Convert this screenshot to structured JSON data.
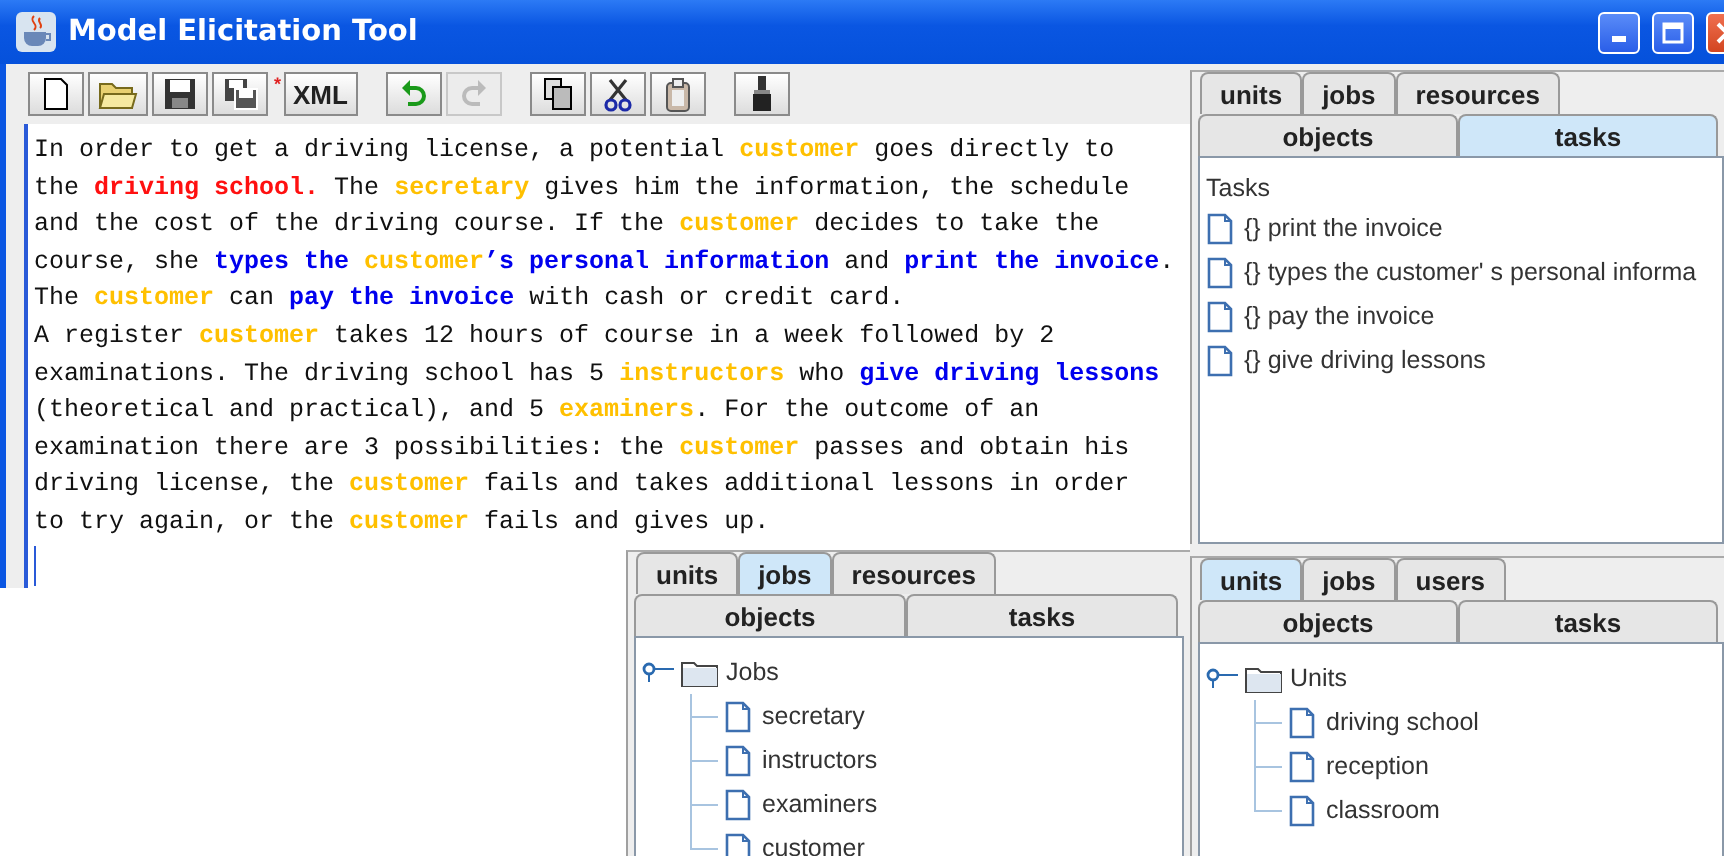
{
  "window": {
    "title": "Model Elicitation Tool"
  },
  "toolbar": {
    "items": [
      {
        "kind": "new",
        "disabled": false
      },
      {
        "kind": "open",
        "disabled": false
      },
      {
        "kind": "save",
        "disabled": false
      },
      {
        "kind": "saveas",
        "disabled": false
      },
      {
        "kind": "mark",
        "text": "*",
        "disabled": false
      },
      {
        "kind": "text",
        "text": "XML",
        "disabled": false
      },
      {
        "kind": "undo",
        "disabled": false
      },
      {
        "kind": "redo",
        "disabled": true
      },
      {
        "kind": "copy",
        "disabled": false
      },
      {
        "kind": "cut",
        "disabled": false
      },
      {
        "kind": "paste",
        "disabled": false
      },
      {
        "kind": "brush",
        "disabled": false
      }
    ]
  },
  "editor": {
    "lines": [
      [
        {
          "kind": "plain",
          "text": "In order to get a driving license, a potential "
        },
        {
          "kind": "job",
          "text": "customer"
        },
        {
          "kind": "plain",
          "text": " goes directly to"
        }
      ],
      [
        {
          "kind": "plain",
          "text": "the "
        },
        {
          "kind": "unit",
          "text": "driving school."
        },
        {
          "kind": "plain",
          "text": " The "
        },
        {
          "kind": "job",
          "text": "secretary"
        },
        {
          "kind": "plain",
          "text": " gives him the information, the schedule"
        }
      ],
      [
        {
          "kind": "plain",
          "text": "and the cost of the driving course. If the "
        },
        {
          "kind": "job",
          "text": "customer"
        },
        {
          "kind": "plain",
          "text": " decides to take the"
        }
      ],
      [
        {
          "kind": "plain",
          "text": "course, she "
        },
        {
          "kind": "task",
          "text": "types the "
        },
        {
          "kind": "job",
          "text": "customer"
        },
        {
          "kind": "task",
          "text": "’s personal information"
        },
        {
          "kind": "plain",
          "text": " and "
        },
        {
          "kind": "task",
          "text": "print the invoice"
        },
        {
          "kind": "plain",
          "text": "."
        }
      ],
      [
        {
          "kind": "plain",
          "text": "The "
        },
        {
          "kind": "job",
          "text": "customer"
        },
        {
          "kind": "plain",
          "text": " can "
        },
        {
          "kind": "task",
          "text": "pay the invoice"
        },
        {
          "kind": "plain",
          "text": " with cash or credit card."
        }
      ],
      [
        {
          "kind": "plain",
          "text": "A register "
        },
        {
          "kind": "job",
          "text": "customer"
        },
        {
          "kind": "plain",
          "text": " takes 12 hours of course in a week followed by 2"
        }
      ],
      [
        {
          "kind": "plain",
          "text": "examinations. The driving school has 5 "
        },
        {
          "kind": "job",
          "text": "instructors"
        },
        {
          "kind": "plain",
          "text": " who "
        },
        {
          "kind": "task",
          "text": "give driving lessons"
        }
      ],
      [
        {
          "kind": "plain",
          "text": "(theoretical and practical), and 5 "
        },
        {
          "kind": "job",
          "text": "examiners"
        },
        {
          "kind": "plain",
          "text": ". For the outcome of an"
        }
      ],
      [
        {
          "kind": "plain",
          "text": "examination there are 3 possibilities: the "
        },
        {
          "kind": "job",
          "text": "customer"
        },
        {
          "kind": "plain",
          "text": " passes and obtain his"
        }
      ],
      [
        {
          "kind": "plain",
          "text": "driving license, the "
        },
        {
          "kind": "job",
          "text": "customer"
        },
        {
          "kind": "plain",
          "text": " fails and takes additional lessons in order"
        }
      ],
      [
        {
          "kind": "plain",
          "text": "to try again, or the "
        },
        {
          "kind": "job",
          "text": "customer"
        },
        {
          "kind": "plain",
          "text": " fails and gives up."
        }
      ]
    ]
  },
  "panels": [
    {
      "tab_rows": [
        [
          {
            "label": "units",
            "selected": false
          },
          {
            "label": "jobs",
            "selected": false
          },
          {
            "label": "resources",
            "selected": false
          }
        ],
        [
          {
            "label": "objects",
            "selected": false
          },
          {
            "label": "tasks",
            "selected": true
          }
        ]
      ],
      "content": {
        "kind": "list",
        "title": "Tasks",
        "items": [
          "{} print the invoice",
          "{} types the customer' s personal informa",
          "{} pay the invoice",
          "{} give driving lessons"
        ]
      }
    },
    {
      "tab_rows": [
        [
          {
            "label": "units",
            "selected": false
          },
          {
            "label": "jobs",
            "selected": true
          },
          {
            "label": "resources",
            "selected": false
          }
        ],
        [
          {
            "label": "objects",
            "selected": false
          },
          {
            "label": "tasks",
            "selected": false
          }
        ]
      ],
      "content": {
        "kind": "tree",
        "root": {
          "label": "Jobs",
          "expanded": true,
          "children": [
            {
              "label": "secretary"
            },
            {
              "label": "instructors"
            },
            {
              "label": "examiners"
            },
            {
              "label": "customer"
            }
          ]
        }
      }
    },
    {
      "tab_rows": [
        [
          {
            "label": "units",
            "selected": true
          },
          {
            "label": "jobs",
            "selected": false
          },
          {
            "label": "users",
            "selected": false
          }
        ],
        [
          {
            "label": "objects",
            "selected": false
          },
          {
            "label": "tasks",
            "selected": false
          }
        ]
      ],
      "content": {
        "kind": "tree",
        "root": {
          "label": "Units",
          "expanded": true,
          "children": [
            {
              "label": "driving school"
            },
            {
              "label": "reception"
            },
            {
              "label": "classroom"
            }
          ]
        }
      }
    }
  ]
}
